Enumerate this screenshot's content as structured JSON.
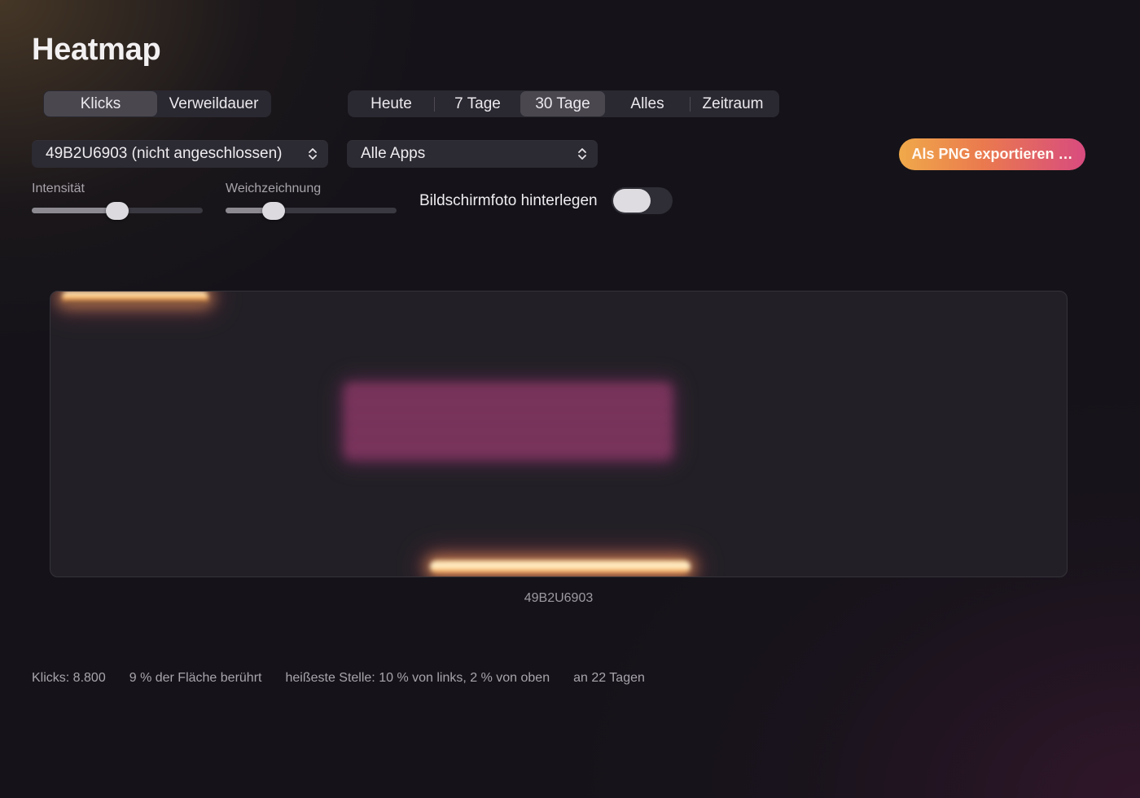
{
  "page": {
    "title": "Heatmap"
  },
  "mode_tabs": [
    {
      "label": "Klicks",
      "active": true
    },
    {
      "label": "Verweildauer",
      "active": false
    }
  ],
  "range_tabs": [
    {
      "label": "Heute",
      "active": false
    },
    {
      "label": "7 Tage",
      "active": false
    },
    {
      "label": "30 Tage",
      "active": true
    },
    {
      "label": "Alles",
      "active": false
    },
    {
      "label": "Zeitraum",
      "active": false
    }
  ],
  "display_select": {
    "value": "49B2U6903 (nicht angeschlossen)",
    "icon": "chevron-updown-icon"
  },
  "app_select": {
    "value": "Alle Apps",
    "icon": "chevron-updown-icon"
  },
  "export_button": {
    "label": "Als PNG exportieren …",
    "gradient": [
      "#f0a94a",
      "#ea7a4e",
      "#d84b7f"
    ]
  },
  "sliders": {
    "intensity": {
      "label": "Intensität",
      "value": 0.5
    },
    "blur": {
      "label": "Weichzeichnung",
      "value": 0.28
    }
  },
  "screenshot_toggle": {
    "label": "Bildschirmfoto hinterlegen",
    "on": false
  },
  "heatmap": {
    "caption": "49B2U6903"
  },
  "stats": {
    "clicks": "Klicks: 8.800",
    "area": "9 % der Fläche berührt",
    "hottest": "heißeste Stelle: 10 % von links, 2 % von oben",
    "days": "an 22 Tagen"
  }
}
